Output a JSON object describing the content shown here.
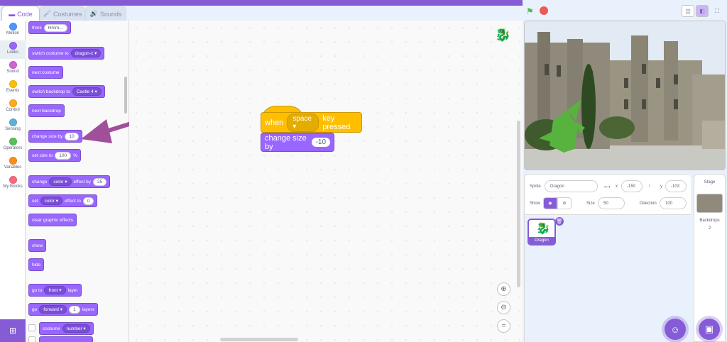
{
  "tabs": {
    "code": "Code",
    "costumes": "Costumes",
    "sounds": "Sounds"
  },
  "categories": [
    {
      "label": "Motion",
      "color": "#4c97ff"
    },
    {
      "label": "Looks",
      "color": "#9966ff"
    },
    {
      "label": "Sound",
      "color": "#cf63cf"
    },
    {
      "label": "Events",
      "color": "#ffbf00"
    },
    {
      "label": "Control",
      "color": "#ffab19"
    },
    {
      "label": "Sensing",
      "color": "#5cb1d6"
    },
    {
      "label": "Operators",
      "color": "#59c059"
    },
    {
      "label": "Variables",
      "color": "#ff8c1a"
    },
    {
      "label": "My Blocks",
      "color": "#ff6680"
    }
  ],
  "palette": {
    "think": "think",
    "think_val": "Hmm...",
    "switch_costume": "switch costume to",
    "costume_val": "dragon-c",
    "next_costume": "next costume",
    "switch_backdrop": "switch backdrop to",
    "backdrop_val": "Castle 4",
    "next_backdrop": "next backdrop",
    "change_size": "change size by",
    "change_size_val": "10",
    "set_size": "set size to",
    "set_size_val": "100",
    "pct": "%",
    "change": "change",
    "effect_val": "color",
    "effect_by": "effect by",
    "change_effect_val": "25",
    "set": "set",
    "set_effect_val": "color",
    "effect_to": "effect to",
    "set_effect_num": "0",
    "clear_effects": "clear graphic effects",
    "show": "show",
    "hide": "hide",
    "go_to": "go to",
    "front_val": "front",
    "layer": "layer",
    "go": "go",
    "forward_val": "forward",
    "layers_num": "1",
    "layers": "layers",
    "costume": "costume",
    "number_val": "number"
  },
  "script": {
    "when": "when",
    "key_val": "space",
    "key_pressed": "key pressed",
    "change_size": "change size by",
    "change_val": "-10",
    "zoom_equal": "="
  },
  "sprite_info": {
    "sprite_label": "Sprite",
    "sprite_name": "Dragon",
    "x_label": "x",
    "x_val": "-150",
    "y_label": "y",
    "y_val": "-103",
    "show_label": "Show",
    "size_label": "Size",
    "size_val": "50",
    "direction_label": "Direction",
    "direction_val": "100"
  },
  "sprites": [
    {
      "name": "Dragon"
    }
  ],
  "stage_panel": {
    "title": "Stage",
    "backdrops_label": "Backdrops",
    "backdrops_count": "2"
  }
}
